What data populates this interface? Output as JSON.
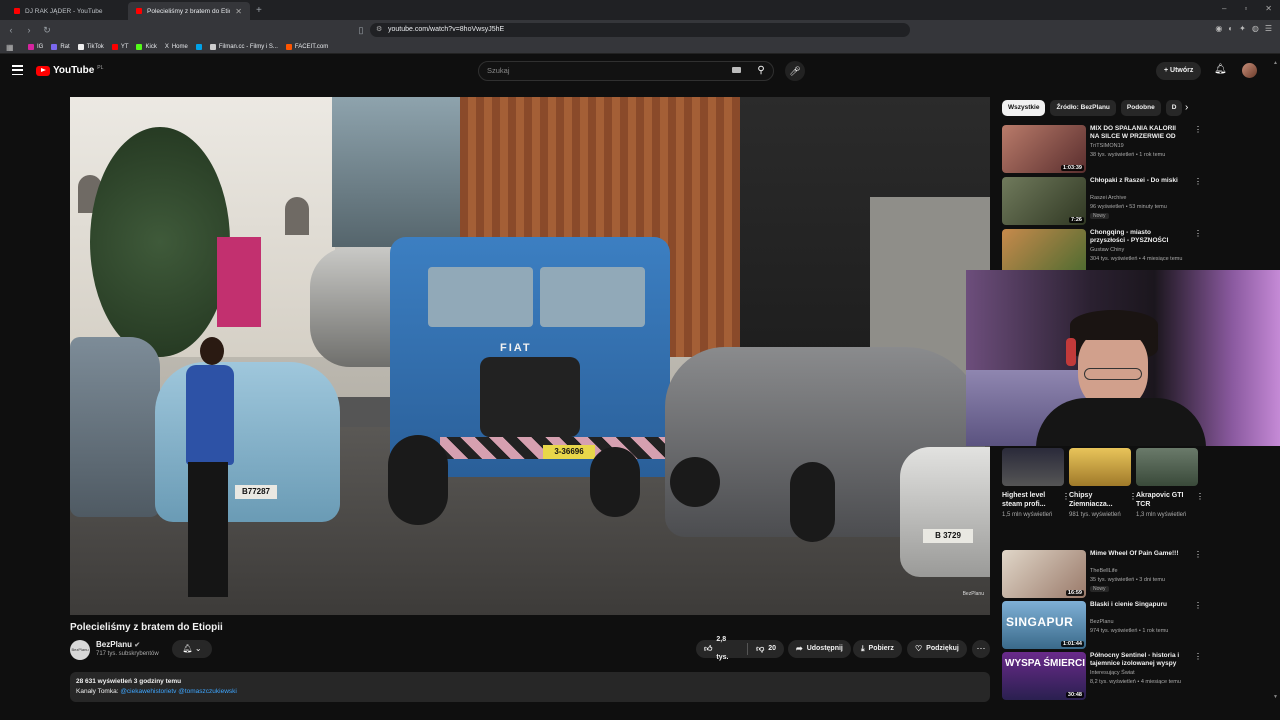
{
  "browser": {
    "tabs": [
      {
        "title": "DJ RAK JĄDER - YouTube",
        "active": false
      },
      {
        "title": "Polecieliśmy z bratem do Etio...",
        "active": true
      }
    ],
    "url": "youtube.com/watch?v=8hoVwsyJ5hE",
    "bookmarks": [
      "IG",
      "Rat",
      "TikTok",
      "YT",
      "Kick",
      "Home",
      "Filman.cc - Filmy i S...",
      "FACEIT.com"
    ],
    "bookmark_colors": [
      "#d6249f",
      "#7b68ee",
      "#ffffff",
      "#ff0000",
      "#53fc18",
      "#ffffff",
      "#00a2e8",
      "#ff5500"
    ],
    "bookmark_x_label": "X"
  },
  "header": {
    "logo": "YouTube",
    "country": "PL",
    "search_placeholder": "Szukaj",
    "create_label": "Utwórz"
  },
  "video": {
    "title": "Polecieliśmy z bratem do Etiopii",
    "channel": "BezPlanu",
    "channel_avatar_text": "BezPlanu",
    "subscribers": "717 tys. subskrybentów",
    "likes": "2,8 tys.",
    "dislikes": "20",
    "share_label": "Udostępnij",
    "download_label": "Pobierz",
    "thanks_label": "Podziękuj",
    "views_time": "28 631 wyświetleń  3 godziny temu",
    "desc_prefix": "Kanały Tomka: ",
    "desc_link1": "@ciekawehistorietv",
    "desc_link2": "@tomaszczukiewski",
    "truck_brand": "FIAT",
    "plate_truck": "3-36696",
    "plate_blue_car": "B77287",
    "plate_white_car": "B 3729",
    "watermark": "BezPlanu"
  },
  "sidebar": {
    "chips": [
      "Wszystkie",
      "Źródło: BezPlanu",
      "Podobne",
      "D"
    ],
    "recs_top": [
      {
        "title": "MIX DO SPALANIA KALORII NA SILCE W PRZERWIE OD PICIA ...",
        "channel": "TriTSIMON19",
        "meta": "38 tys. wyświetleń • 1 rok temu",
        "duration": "1:03:39",
        "badge": ""
      },
      {
        "title": "Chłopaki z Raszei - Do miski",
        "channel": "Raszei Archive",
        "meta": "96 wyświetleń • 53 minuty temu",
        "duration": "7:26",
        "badge": "Nowy"
      },
      {
        "title": "Chongqing - miasto przyszłości - PYSZNOŚCI",
        "channel": "Gustaw Chiny",
        "meta": "304 tys. wyświetleń • 4 miesiące temu",
        "duration": "",
        "badge": ""
      }
    ],
    "shorts": [
      {
        "title": "Highest level steam profi...",
        "views": "1,5 mln wyświetleń"
      },
      {
        "title": "Chipsy Ziemniacza...",
        "views": "981 tys. wyświetleń"
      },
      {
        "title": "Akrapovic GTI TCR",
        "views": "1,3 mln wyświetleń"
      }
    ],
    "recs_bottom": [
      {
        "title": "Mime Wheel Of Pain Game!!!",
        "channel": "TheBellLife",
        "meta": "35 tys. wyświetleń • 3 dni temu",
        "duration": "16:59",
        "badge": "Nowy"
      },
      {
        "title": "Blaski i cienie Singapuru",
        "channel": "BezPlanu",
        "meta": "974 tys. wyświetleń • 1 rok temu",
        "duration": "1:01:44",
        "badge": "",
        "thumb_text": "SINGAPUR"
      },
      {
        "title": "Północny Sentinel - historia i tajemnice izolowanej wyspy",
        "channel": "Interesujący Świat",
        "meta": "8,2 tys. wyświetleń • 4 miesiące temu",
        "duration": "30:48",
        "badge": "",
        "thumb_text": "WYSPA ŚMIERCI"
      }
    ]
  },
  "icons": {
    "menu": "hamburger-icon",
    "search": "search-icon",
    "mic": "mic-icon",
    "bell": "bell-icon",
    "like": "thumbs-up-icon",
    "dislike": "thumbs-down-icon",
    "share": "share-icon",
    "download": "download-icon",
    "thanks": "heart-dollar-icon"
  },
  "colors": {
    "background": "#0f0f0f",
    "accent": "#ff0000",
    "link": "#3ea6ff",
    "pill": "#272727"
  }
}
